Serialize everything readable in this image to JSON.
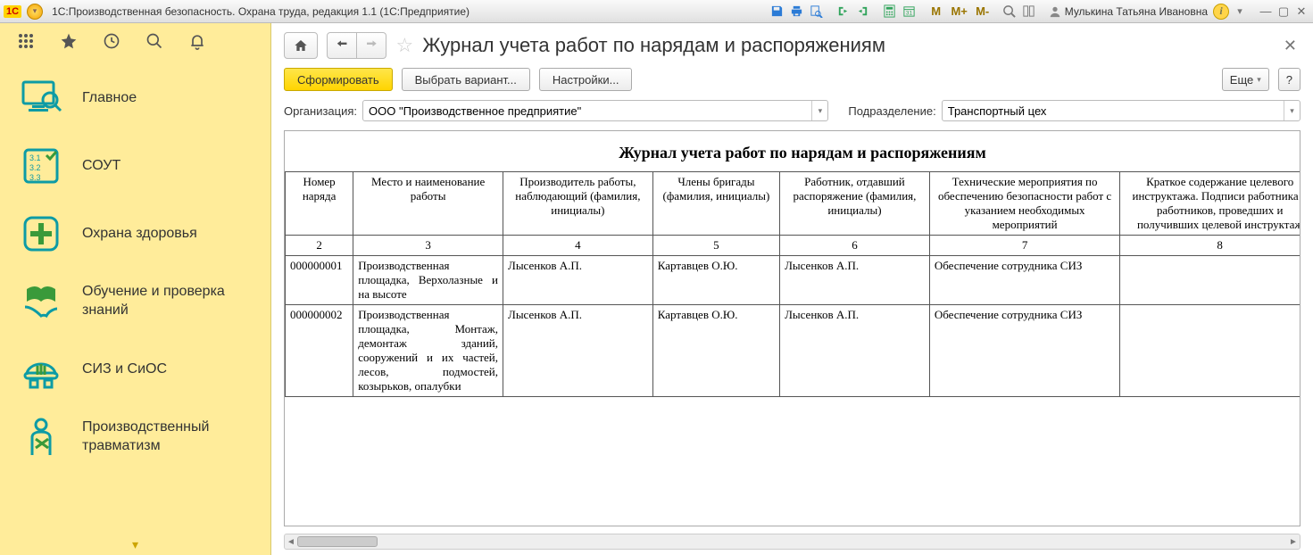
{
  "titlebar": {
    "app_title": "1С:Производственная безопасность. Охрана труда, редакция 1.1  (1С:Предприятие)",
    "user_name": "Мулькина Татьяна Ивановна"
  },
  "sidebar": {
    "items": [
      {
        "label": "Главное"
      },
      {
        "label": "СОУТ"
      },
      {
        "label": "Охрана здоровья"
      },
      {
        "label": "Обучение и проверка знаний"
      },
      {
        "label": "СИЗ и СиОС"
      },
      {
        "label": "Производственный травматизм"
      }
    ]
  },
  "page": {
    "title": "Журнал учета работ по нарядам и распоряжениям"
  },
  "cmd": {
    "form": "Сформировать",
    "variant": "Выбрать вариант...",
    "settings": "Настройки...",
    "more": "Еще",
    "help": "?"
  },
  "filters": {
    "org_label": "Организация:",
    "org_value": "ООО \"Производственное предприятие\"",
    "dep_label": "Подразделение:",
    "dep_value": "Транспортный цех"
  },
  "report": {
    "title": "Журнал учета работ по нарядам и распоряжениям",
    "columns": [
      "Номер наряда",
      "Место и наименование работы",
      "Производитель работы, наблюдающий (фамилия, инициалы)",
      "Члены бригады (фамилия, инициалы)",
      "Работник, отдавший распоряжение (фамилия, инициалы)",
      "Технические мероприятия по обеспечению безопасности работ с указанием необходимых мероприятий",
      "Краткое содержание целевого инструктажа. Подписи работника и работников, проведших и получивших целевой инструктаж"
    ],
    "colnums": [
      "2",
      "3",
      "4",
      "5",
      "6",
      "7",
      "8"
    ],
    "rows": [
      {
        "num": "000000001",
        "place": "Производственная площадка, Верхолазные и на высоте",
        "producer": "Лысенков А.П.",
        "members": "Картавцев О.Ю.",
        "orderer": "Лысенков А.П.",
        "measures": "Обеспечение сотрудника СИЗ",
        "brief": ""
      },
      {
        "num": "000000002",
        "place": "Производственная площадка, Монтаж, демонтаж зданий, сооружений и их частей, лесов, подмостей, козырьков, опалубки",
        "producer": "Лысенков А.П.",
        "members": "Картавцев О.Ю.",
        "orderer": "Лысенков А.П.",
        "measures": "Обеспечение сотрудника СИЗ",
        "brief": ""
      }
    ]
  }
}
